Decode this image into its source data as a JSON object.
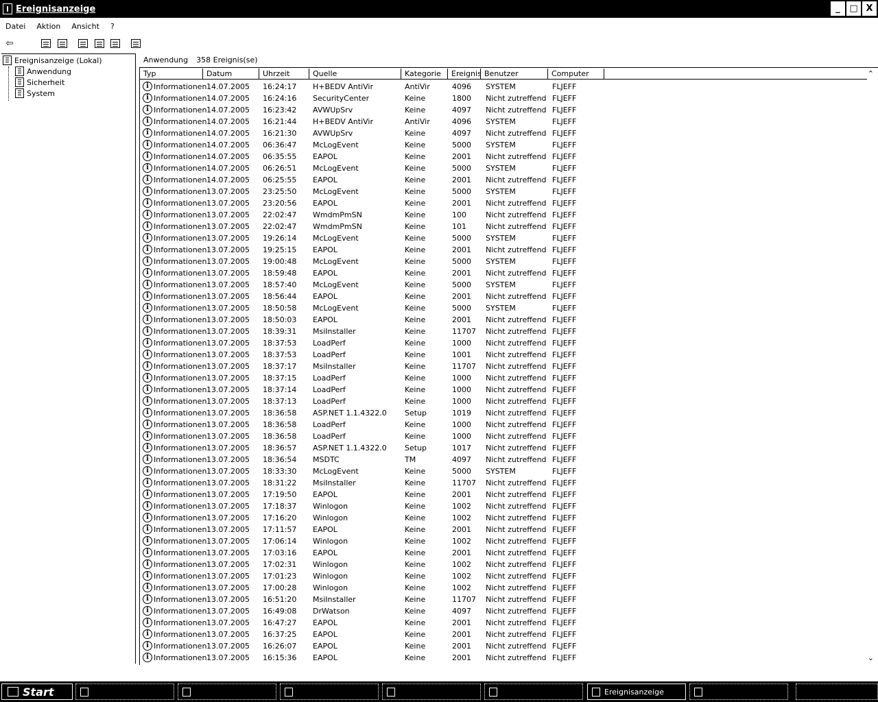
{
  "window": {
    "title": "Ereignisanzeige"
  },
  "window_buttons": {
    "minimize": "_",
    "maximize": "□",
    "close": "X"
  },
  "menu": [
    "Datei",
    "Aktion",
    "Ansicht",
    "?"
  ],
  "toolbar": {
    "back_glyph": "⇦"
  },
  "tree": {
    "root": "Ereignisanzeige (Lokal)",
    "children": [
      "Anwendung",
      "Sicherheit",
      "System"
    ]
  },
  "content_header": {
    "log_name": "Anwendung",
    "count": "358 Ereignis(se)"
  },
  "columns": [
    "Typ",
    "Datum",
    "Uhrzeit",
    "Quelle",
    "Kategorie",
    "Ereignis",
    "Benutzer",
    "Computer"
  ],
  "info_glyph": "i",
  "events": [
    [
      "Informationen",
      "14.07.2005",
      "16:24:17",
      "H+BEDV AntiVir",
      "AntiVir",
      "4096",
      "SYSTEM",
      "FLJEFF"
    ],
    [
      "Informationen",
      "14.07.2005",
      "16:24:16",
      "SecurityCenter",
      "Keine",
      "1800",
      "Nicht zutreffend",
      "FLJEFF"
    ],
    [
      "Informationen",
      "14.07.2005",
      "16:23:42",
      "AVWUpSrv",
      "Keine",
      "4097",
      "Nicht zutreffend",
      "FLJEFF"
    ],
    [
      "Informationen",
      "14.07.2005",
      "16:21:44",
      "H+BEDV AntiVir",
      "AntiVir",
      "4096",
      "SYSTEM",
      "FLJEFF"
    ],
    [
      "Informationen",
      "14.07.2005",
      "16:21:30",
      "AVWUpSrv",
      "Keine",
      "4097",
      "Nicht zutreffend",
      "FLJEFF"
    ],
    [
      "Informationen",
      "14.07.2005",
      "06:36:47",
      "McLogEvent",
      "Keine",
      "5000",
      "SYSTEM",
      "FLJEFF"
    ],
    [
      "Informationen",
      "14.07.2005",
      "06:35:55",
      "EAPOL",
      "Keine",
      "2001",
      "Nicht zutreffend",
      "FLJEFF"
    ],
    [
      "Informationen",
      "14.07.2005",
      "06:26:51",
      "McLogEvent",
      "Keine",
      "5000",
      "SYSTEM",
      "FLJEFF"
    ],
    [
      "Informationen",
      "14.07.2005",
      "06:25:55",
      "EAPOL",
      "Keine",
      "2001",
      "Nicht zutreffend",
      "FLJEFF"
    ],
    [
      "Informationen",
      "13.07.2005",
      "23:25:50",
      "McLogEvent",
      "Keine",
      "5000",
      "SYSTEM",
      "FLJEFF"
    ],
    [
      "Informationen",
      "13.07.2005",
      "23:20:56",
      "EAPOL",
      "Keine",
      "2001",
      "Nicht zutreffend",
      "FLJEFF"
    ],
    [
      "Informationen",
      "13.07.2005",
      "22:02:47",
      "WmdmPmSN",
      "Keine",
      "100",
      "Nicht zutreffend",
      "FLJEFF"
    ],
    [
      "Informationen",
      "13.07.2005",
      "22:02:47",
      "WmdmPmSN",
      "Keine",
      "101",
      "Nicht zutreffend",
      "FLJEFF"
    ],
    [
      "Informationen",
      "13.07.2005",
      "19:26:14",
      "McLogEvent",
      "Keine",
      "5000",
      "SYSTEM",
      "FLJEFF"
    ],
    [
      "Informationen",
      "13.07.2005",
      "19:25:15",
      "EAPOL",
      "Keine",
      "2001",
      "Nicht zutreffend",
      "FLJEFF"
    ],
    [
      "Informationen",
      "13.07.2005",
      "19:00:48",
      "McLogEvent",
      "Keine",
      "5000",
      "SYSTEM",
      "FLJEFF"
    ],
    [
      "Informationen",
      "13.07.2005",
      "18:59:48",
      "EAPOL",
      "Keine",
      "2001",
      "Nicht zutreffend",
      "FLJEFF"
    ],
    [
      "Informationen",
      "13.07.2005",
      "18:57:40",
      "McLogEvent",
      "Keine",
      "5000",
      "SYSTEM",
      "FLJEFF"
    ],
    [
      "Informationen",
      "13.07.2005",
      "18:56:44",
      "EAPOL",
      "Keine",
      "2001",
      "Nicht zutreffend",
      "FLJEFF"
    ],
    [
      "Informationen",
      "13.07.2005",
      "18:50:58",
      "McLogEvent",
      "Keine",
      "5000",
      "SYSTEM",
      "FLJEFF"
    ],
    [
      "Informationen",
      "13.07.2005",
      "18:50:03",
      "EAPOL",
      "Keine",
      "2001",
      "Nicht zutreffend",
      "FLJEFF"
    ],
    [
      "Informationen",
      "13.07.2005",
      "18:39:31",
      "MsiInstaller",
      "Keine",
      "11707",
      "Nicht zutreffend",
      "FLJEFF"
    ],
    [
      "Informationen",
      "13.07.2005",
      "18:37:53",
      "LoadPerf",
      "Keine",
      "1000",
      "Nicht zutreffend",
      "FLJEFF"
    ],
    [
      "Informationen",
      "13.07.2005",
      "18:37:53",
      "LoadPerf",
      "Keine",
      "1001",
      "Nicht zutreffend",
      "FLJEFF"
    ],
    [
      "Informationen",
      "13.07.2005",
      "18:37:17",
      "MsiInstaller",
      "Keine",
      "11707",
      "Nicht zutreffend",
      "FLJEFF"
    ],
    [
      "Informationen",
      "13.07.2005",
      "18:37:15",
      "LoadPerf",
      "Keine",
      "1000",
      "Nicht zutreffend",
      "FLJEFF"
    ],
    [
      "Informationen",
      "13.07.2005",
      "18:37:14",
      "LoadPerf",
      "Keine",
      "1000",
      "Nicht zutreffend",
      "FLJEFF"
    ],
    [
      "Informationen",
      "13.07.2005",
      "18:37:13",
      "LoadPerf",
      "Keine",
      "1000",
      "Nicht zutreffend",
      "FLJEFF"
    ],
    [
      "Informationen",
      "13.07.2005",
      "18:36:58",
      "ASP.NET 1.1.4322.0",
      "Setup",
      "1019",
      "Nicht zutreffend",
      "FLJEFF"
    ],
    [
      "Informationen",
      "13.07.2005",
      "18:36:58",
      "LoadPerf",
      "Keine",
      "1000",
      "Nicht zutreffend",
      "FLJEFF"
    ],
    [
      "Informationen",
      "13.07.2005",
      "18:36:58",
      "LoadPerf",
      "Keine",
      "1000",
      "Nicht zutreffend",
      "FLJEFF"
    ],
    [
      "Informationen",
      "13.07.2005",
      "18:36:57",
      "ASP.NET 1.1.4322.0",
      "Setup",
      "1017",
      "Nicht zutreffend",
      "FLJEFF"
    ],
    [
      "Informationen",
      "13.07.2005",
      "18:36:54",
      "MSDTC",
      "TM",
      "4097",
      "Nicht zutreffend",
      "FLJEFF"
    ],
    [
      "Informationen",
      "13.07.2005",
      "18:33:30",
      "McLogEvent",
      "Keine",
      "5000",
      "SYSTEM",
      "FLJEFF"
    ],
    [
      "Informationen",
      "13.07.2005",
      "18:31:22",
      "MsiInstaller",
      "Keine",
      "11707",
      "Nicht zutreffend",
      "FLJEFF"
    ],
    [
      "Informationen",
      "13.07.2005",
      "17:19:50",
      "EAPOL",
      "Keine",
      "2001",
      "Nicht zutreffend",
      "FLJEFF"
    ],
    [
      "Informationen",
      "13.07.2005",
      "17:18:37",
      "Winlogon",
      "Keine",
      "1002",
      "Nicht zutreffend",
      "FLJEFF"
    ],
    [
      "Informationen",
      "13.07.2005",
      "17:16:20",
      "Winlogon",
      "Keine",
      "1002",
      "Nicht zutreffend",
      "FLJEFF"
    ],
    [
      "Informationen",
      "13.07.2005",
      "17:11:57",
      "EAPOL",
      "Keine",
      "2001",
      "Nicht zutreffend",
      "FLJEFF"
    ],
    [
      "Informationen",
      "13.07.2005",
      "17:06:14",
      "Winlogon",
      "Keine",
      "1002",
      "Nicht zutreffend",
      "FLJEFF"
    ],
    [
      "Informationen",
      "13.07.2005",
      "17:03:16",
      "EAPOL",
      "Keine",
      "2001",
      "Nicht zutreffend",
      "FLJEFF"
    ],
    [
      "Informationen",
      "13.07.2005",
      "17:02:31",
      "Winlogon",
      "Keine",
      "1002",
      "Nicht zutreffend",
      "FLJEFF"
    ],
    [
      "Informationen",
      "13.07.2005",
      "17:01:23",
      "Winlogon",
      "Keine",
      "1002",
      "Nicht zutreffend",
      "FLJEFF"
    ],
    [
      "Informationen",
      "13.07.2005",
      "17:00:28",
      "Winlogon",
      "Keine",
      "1002",
      "Nicht zutreffend",
      "FLJEFF"
    ],
    [
      "Informationen",
      "13.07.2005",
      "16:51:20",
      "MsiInstaller",
      "Keine",
      "11707",
      "Nicht zutreffend",
      "FLJEFF"
    ],
    [
      "Informationen",
      "13.07.2005",
      "16:49:08",
      "DrWatson",
      "Keine",
      "4097",
      "Nicht zutreffend",
      "FLJEFF"
    ],
    [
      "Informationen",
      "13.07.2005",
      "16:47:27",
      "EAPOL",
      "Keine",
      "2001",
      "Nicht zutreffend",
      "FLJEFF"
    ],
    [
      "Informationen",
      "13.07.2005",
      "16:37:25",
      "EAPOL",
      "Keine",
      "2001",
      "Nicht zutreffend",
      "FLJEFF"
    ],
    [
      "Informationen",
      "13.07.2005",
      "16:26:07",
      "EAPOL",
      "Keine",
      "2001",
      "Nicht zutreffend",
      "FLJEFF"
    ],
    [
      "Informationen",
      "13.07.2005",
      "16:15:36",
      "EAPOL",
      "Keine",
      "2001",
      "Nicht zutreffend",
      "FLJEFF"
    ]
  ],
  "taskbar": {
    "start_label": "Start",
    "active_task": "Ereignisanzeige"
  }
}
